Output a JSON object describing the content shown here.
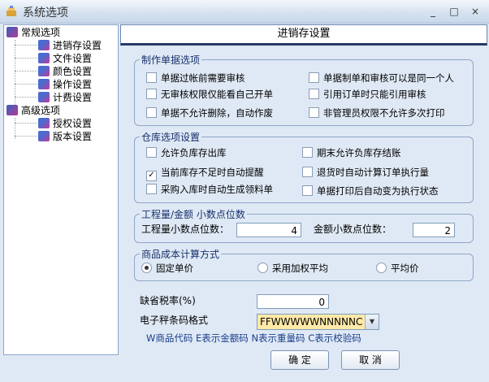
{
  "window": {
    "title": "系统选项",
    "minimize": "_",
    "maximize": "□",
    "close": "×"
  },
  "tree": {
    "groups": [
      {
        "label": "常规选项",
        "items": [
          "进销存设置",
          "文件设置",
          "颜色设置",
          "操作设置",
          "计费设置"
        ]
      },
      {
        "label": "高级选项",
        "items": [
          "授权设置",
          "版本设置"
        ]
      }
    ]
  },
  "panel": {
    "title": "进销存设置"
  },
  "document_options": {
    "legend": "制作单据选项",
    "items": [
      {
        "label": "单据过帐前需要审核",
        "checked": false
      },
      {
        "label": "单据制单和审核可以是同一个人",
        "checked": false
      },
      {
        "label": "无审核权限仅能看自己开单",
        "checked": false
      },
      {
        "label": "引用订单时只能引用审核",
        "checked": false
      },
      {
        "label": "单据不允许删除，自动作废",
        "checked": false
      },
      {
        "label": "非管理员权限不允许多次打印",
        "checked": false
      }
    ]
  },
  "warehouse_options": {
    "legend": "仓库选项设置",
    "items": [
      {
        "label": "允许负库存出库",
        "checked": false
      },
      {
        "label": "期末允许负库存结账",
        "checked": false
      },
      {
        "label": "当前库存不足时自动提醒",
        "checked": true
      },
      {
        "label": "退货时自动计算订单执行量",
        "checked": false
      },
      {
        "label": "采购入库时自动生成领料单",
        "checked": false
      },
      {
        "label": "单据打印后自动变为执行状态",
        "checked": false
      }
    ]
  },
  "decimals": {
    "legend": "工程量/金额  小数点位数",
    "quantity_label": "工程量小数点位数：",
    "quantity_value": "4",
    "amount_label": "金额小数点位数：",
    "amount_value": "2"
  },
  "cost": {
    "legend": "商品成本计算方式",
    "options": [
      {
        "label": "固定单价",
        "selected": true
      },
      {
        "label": "采用加权平均",
        "selected": false
      },
      {
        "label": "平均价",
        "selected": false
      }
    ]
  },
  "tax": {
    "label": "缺省税率(%)",
    "value": "0"
  },
  "barcode": {
    "label": "电子秤条码格式",
    "value": "FFWWWWWNNNNNC",
    "note": "W商品代码 E表示金额码 N表示重量码 C表示校验码"
  },
  "buttons": {
    "ok": "确 定",
    "cancel": "取 消"
  },
  "colors": {
    "accent": "#233a66",
    "background": "#dfe9f5",
    "dropdown": "#ffe9a8"
  }
}
